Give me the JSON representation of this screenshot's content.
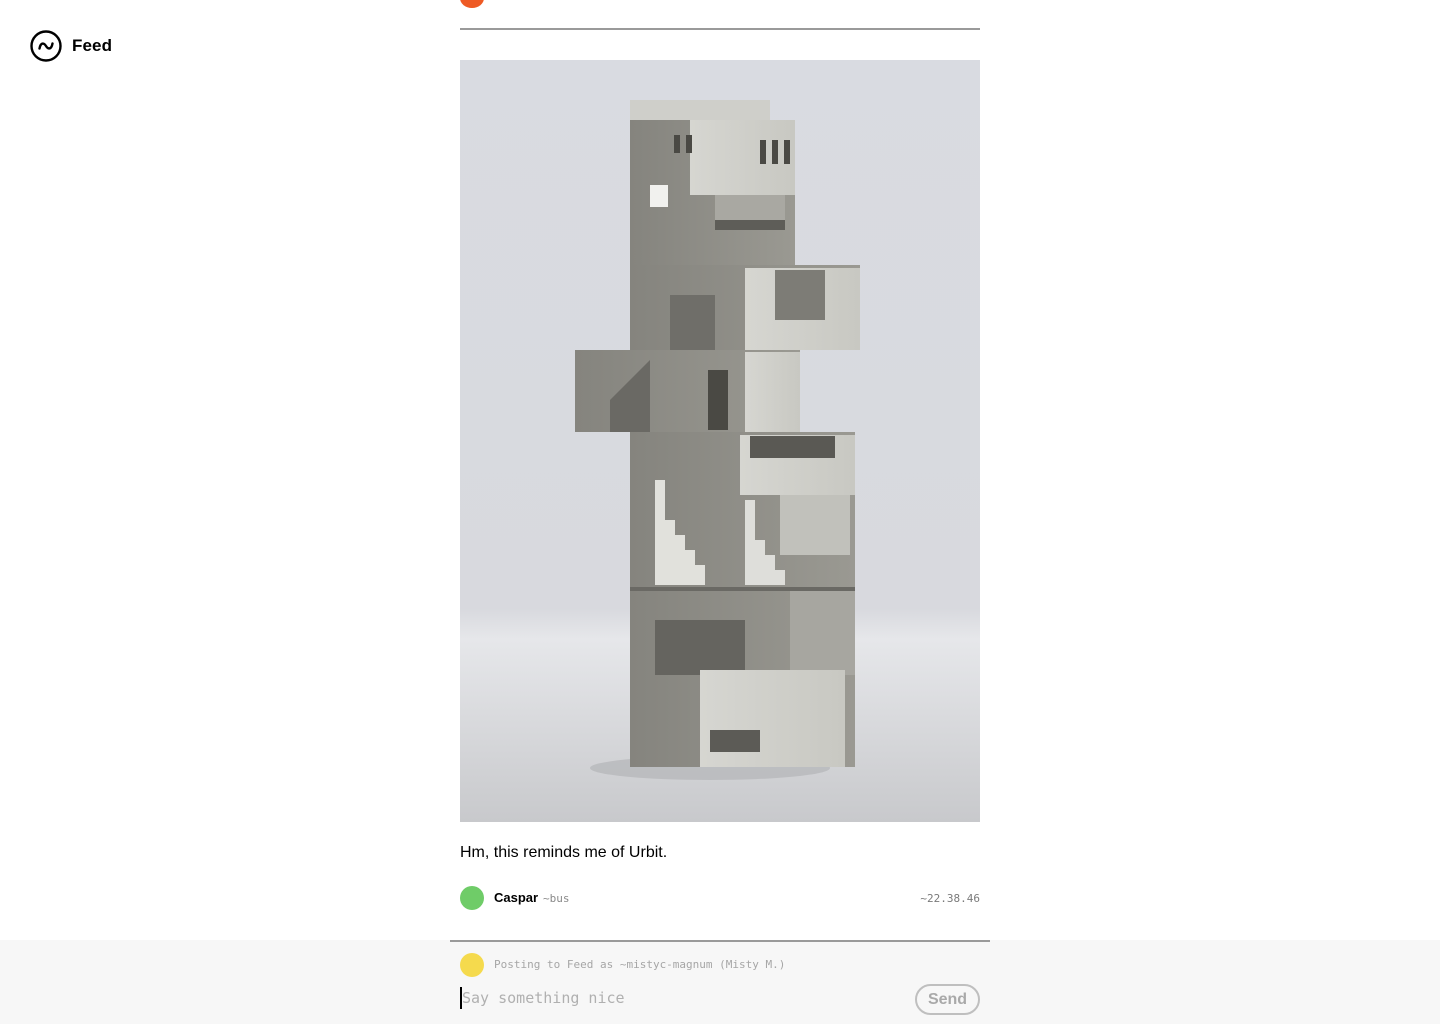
{
  "app": {
    "title": "Feed",
    "icon": "tilde-circle-icon"
  },
  "post": {
    "image": {
      "subject": "stacked concrete architecture sculpture",
      "background_color": "#dcdee4",
      "model_color": "#7c7b75"
    },
    "body": "Hm, this reminds me of Urbit.",
    "author": {
      "name": "Caspar",
      "ship": "~bus",
      "avatar_color": "#6fcc68"
    },
    "time": "~22.38.46"
  },
  "previous_post": {
    "avatar_color": "#ee5a24"
  },
  "composer": {
    "avatar_color": "#f5da4d",
    "context": "Posting to Feed as ~mistyc-magnum (Misty M.)",
    "placeholder": "Say something nice",
    "value": "",
    "send_label": "Send"
  }
}
